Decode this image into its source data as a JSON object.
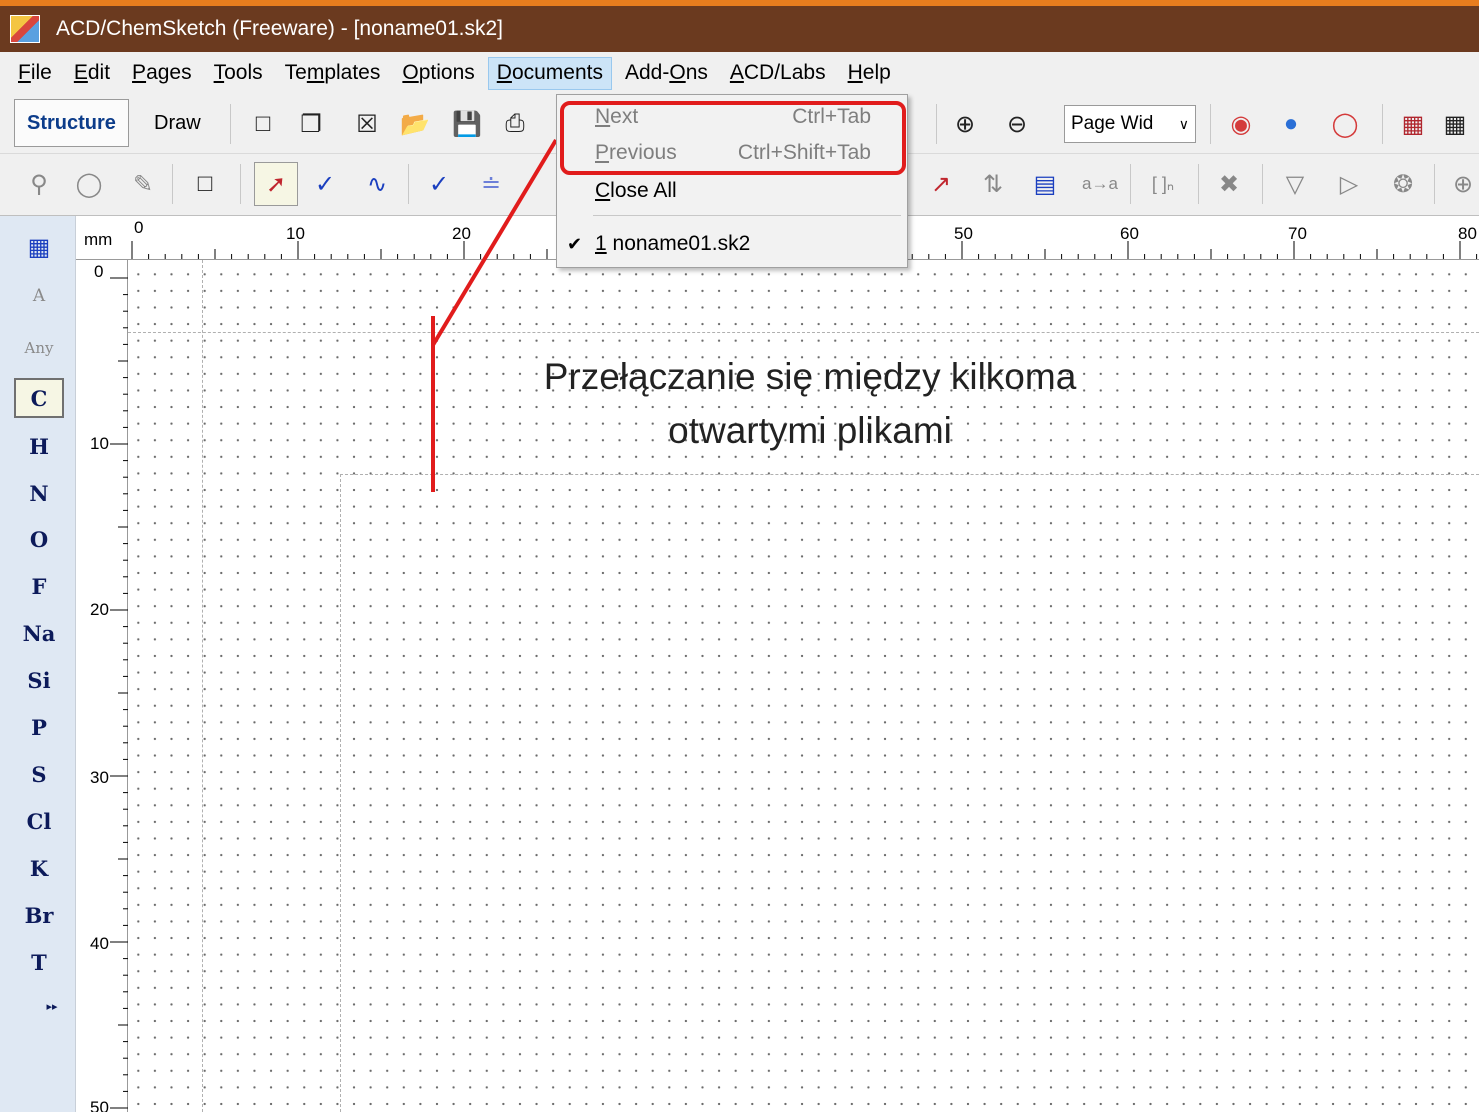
{
  "window": {
    "title": "ACD/ChemSketch (Freeware) - [noname01.sk2]"
  },
  "menubar": [
    {
      "label_pre": "",
      "mn": "F",
      "label_post": "ile"
    },
    {
      "label_pre": "",
      "mn": "E",
      "label_post": "dit"
    },
    {
      "label_pre": "",
      "mn": "P",
      "label_post": "ages"
    },
    {
      "label_pre": "",
      "mn": "T",
      "label_post": "ools"
    },
    {
      "label_pre": "Te",
      "mn": "m",
      "label_post": "plates"
    },
    {
      "label_pre": "",
      "mn": "O",
      "label_post": "ptions"
    },
    {
      "label_pre": "",
      "mn": "D",
      "label_post": "ocuments"
    },
    {
      "label_pre": "Add-",
      "mn": "O",
      "label_post": "ns"
    },
    {
      "label_pre": "",
      "mn": "A",
      "label_post": "CD/Labs"
    },
    {
      "label_pre": "",
      "mn": "H",
      "label_post": "elp"
    }
  ],
  "toolbar": {
    "mode_structure": "Structure",
    "mode_draw": "Draw",
    "zoom_value": "Page Wid"
  },
  "documents_menu": {
    "next_pre": "",
    "next_mn": "N",
    "next_post": "ext",
    "next_shortcut": "Ctrl+Tab",
    "prev_pre": "",
    "prev_mn": "P",
    "prev_post": "revious",
    "prev_shortcut": "Ctrl+Shift+Tab",
    "closeall_pre": "",
    "closeall_mn": "C",
    "closeall_post": "lose All",
    "doc_check": "✔",
    "doc_mn": "1",
    "doc_post": " noname01.sk2"
  },
  "ruler": {
    "unit": "mm",
    "top_labels": [
      "0",
      "10",
      "20",
      "50",
      "60",
      "70",
      "80"
    ],
    "left_labels": [
      "0",
      "10",
      "20",
      "30",
      "40",
      "50"
    ]
  },
  "palette": {
    "tool_a": "A",
    "tool_any": "Any",
    "elements": [
      "C",
      "H",
      "N",
      "O",
      "F",
      "Na",
      "Si",
      "P",
      "S",
      "Cl",
      "K",
      "Br",
      "T"
    ],
    "more": "▸▸"
  },
  "annotation": {
    "line1": "Przełączanie się między kilkoma",
    "line2": "otwartymi plikami"
  },
  "colors": {
    "titlebar": "#6b3a1f",
    "accent_strip": "#e87d1e",
    "highlight": "#e11c1c",
    "menu_active": "#cce4f7"
  }
}
